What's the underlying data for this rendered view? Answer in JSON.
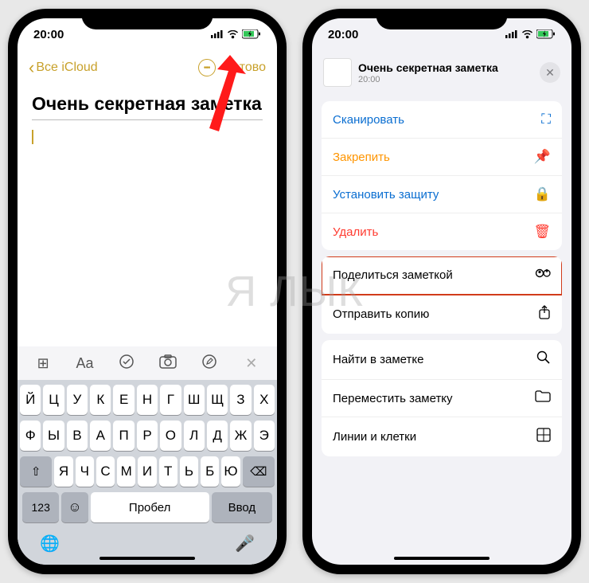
{
  "status": {
    "time": "20:00"
  },
  "phone1": {
    "back_label": "Все iCloud",
    "done_label": "Готово",
    "note_title": "Очень секретная заметка",
    "toolbar": {
      "table": "⊞",
      "format": "Aa",
      "checklist": "☑",
      "camera": "◯⃝",
      "pencil": "✎",
      "close": "✕"
    },
    "keyboard": {
      "row1": [
        "Й",
        "Ц",
        "У",
        "К",
        "Е",
        "Н",
        "Г",
        "Ш",
        "Щ",
        "З",
        "Х"
      ],
      "row2": [
        "Ф",
        "Ы",
        "В",
        "А",
        "П",
        "Р",
        "О",
        "Л",
        "Д",
        "Ж",
        "Э"
      ],
      "row3": [
        "Я",
        "Ч",
        "С",
        "М",
        "И",
        "Т",
        "Ь",
        "Б",
        "Ю"
      ],
      "shift": "⇧",
      "del": "⌫",
      "k123": "123",
      "emoji": "☺",
      "space": "Пробел",
      "enter": "Ввод",
      "globe": "🌐",
      "mic": "🎤"
    }
  },
  "phone2": {
    "sheet_title": "Очень секретная заметка",
    "sheet_time": "20:00",
    "actions": {
      "scan": "Сканировать",
      "pin": "Закрепить",
      "lock": "Установить защиту",
      "delete": "Удалить",
      "share_note": "Поделиться заметкой",
      "send_copy": "Отправить копию",
      "find": "Найти в заметке",
      "move": "Переместить заметку",
      "lines": "Линии и клетки"
    },
    "icons": {
      "scan": "⛶",
      "pin": "📌",
      "lock": "🔒",
      "delete": "🗑",
      "share_note": "⊕",
      "send_copy": "⇪",
      "find": "🔍",
      "move": "🗂",
      "lines": "⊞",
      "close": "✕"
    }
  },
  "watermark": "Я ЛЫК"
}
